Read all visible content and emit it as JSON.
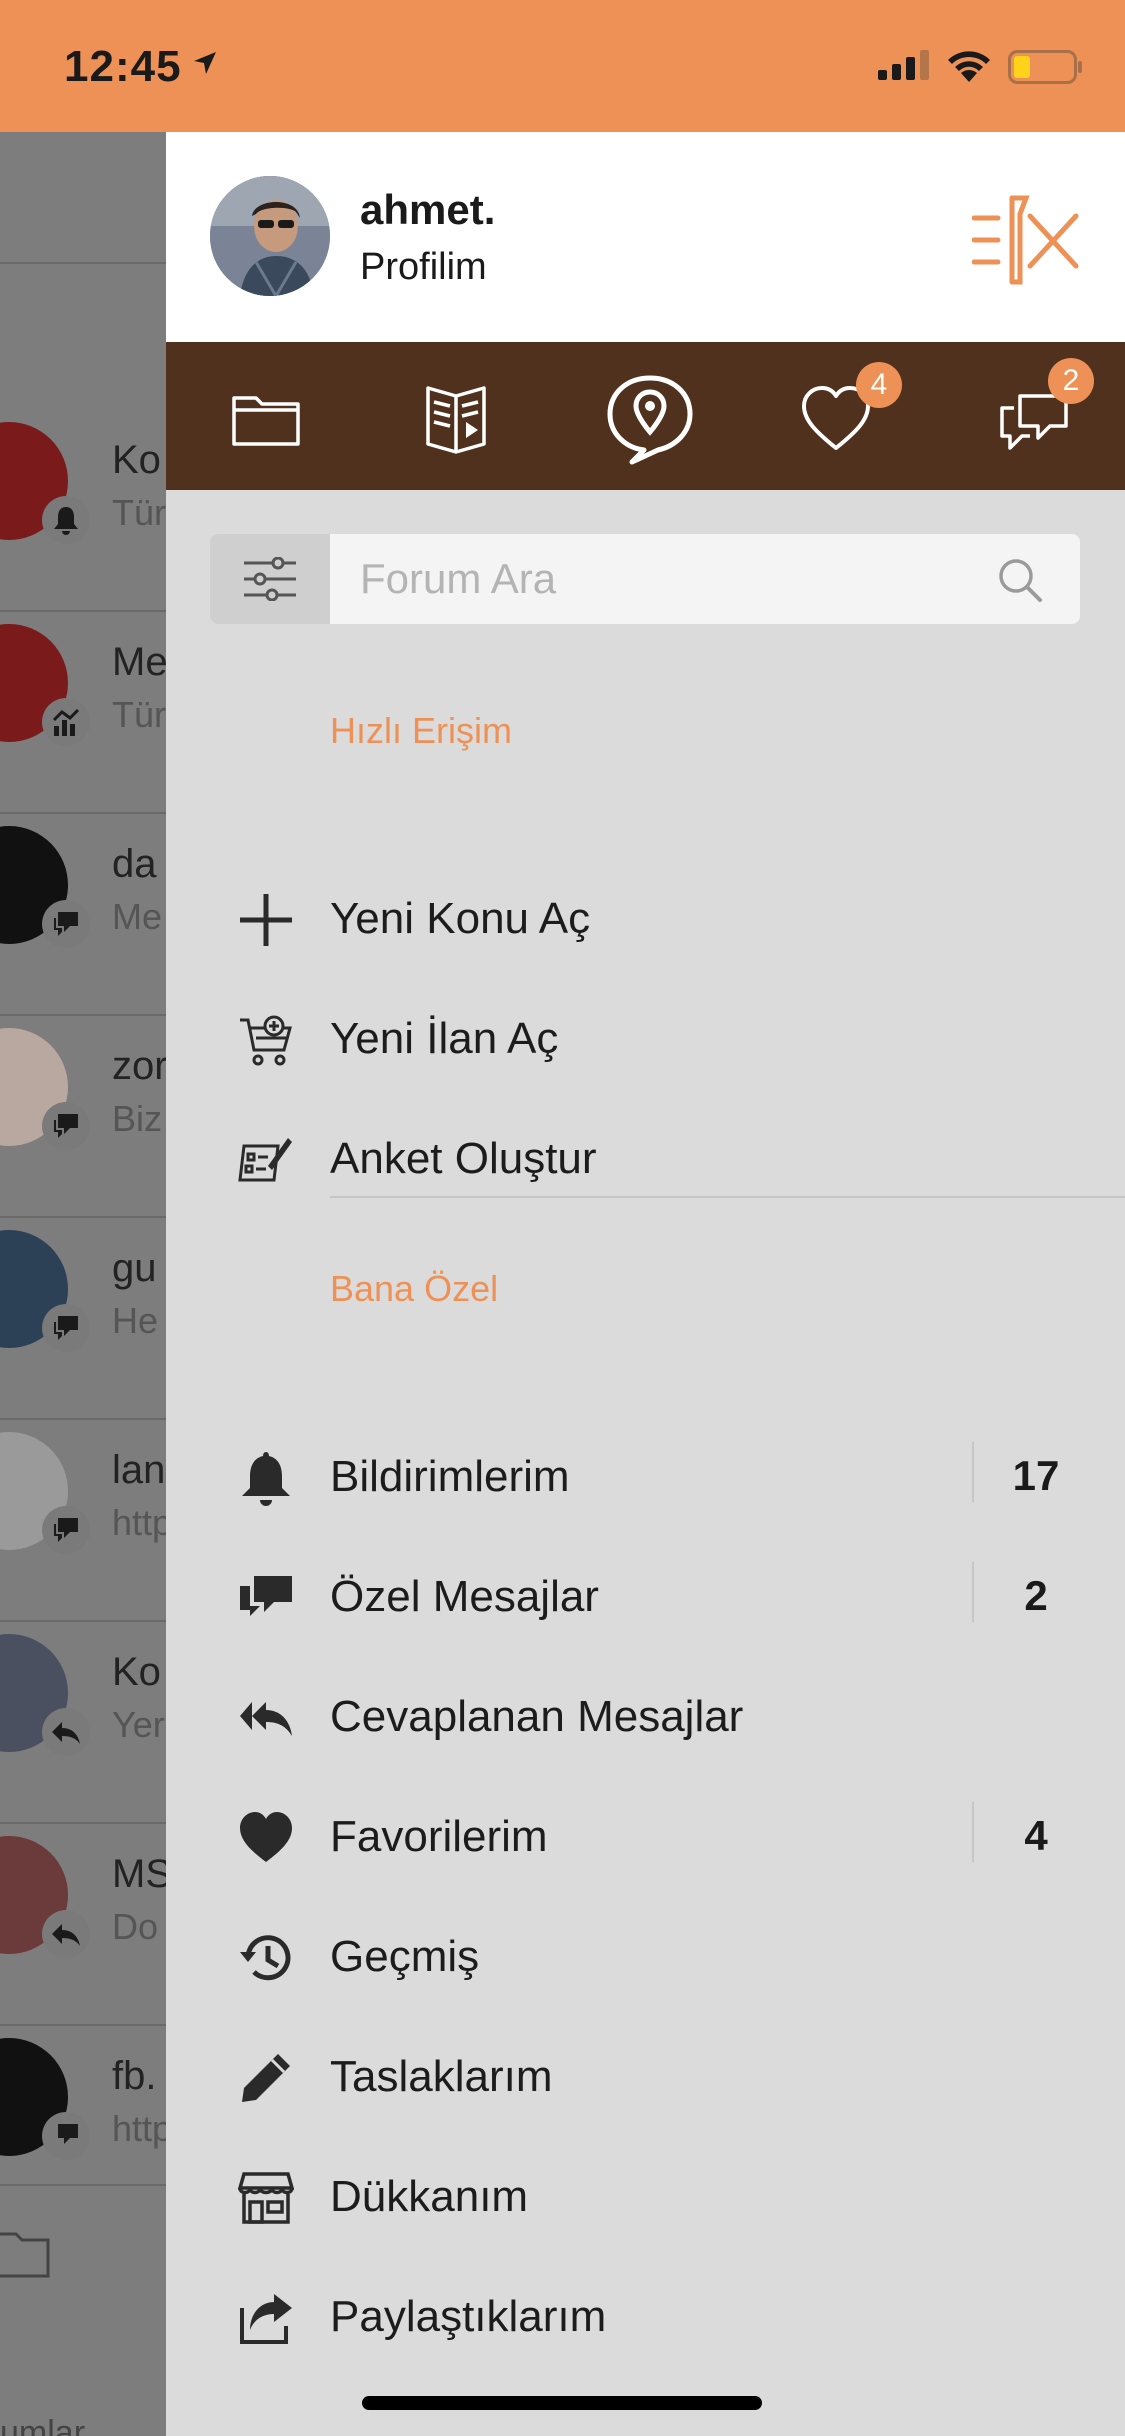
{
  "status_bar": {
    "time": "12:45"
  },
  "background_list": {
    "rows": [
      {
        "title": "Ko",
        "subtitle": "Tür"
      },
      {
        "title": "Me",
        "subtitle": "Tür"
      },
      {
        "title": "da",
        "subtitle": "Me"
      },
      {
        "title": "zor",
        "subtitle": "Biz"
      },
      {
        "title": "gu",
        "subtitle": "He"
      },
      {
        "title": "lan",
        "subtitle": "http"
      },
      {
        "title": "Ko",
        "subtitle": "Yer"
      },
      {
        "title": "MS",
        "subtitle": "Do"
      },
      {
        "title": "fb.",
        "subtitle": "http"
      }
    ],
    "tab_label": "umlar"
  },
  "profile": {
    "username": "ahmet.",
    "link_label": "Profilim"
  },
  "icon_bar": {
    "favorites_badge": "4",
    "messages_badge": "2"
  },
  "search": {
    "placeholder": "Forum Ara"
  },
  "quick_access": {
    "title": "Hızlı Erişim",
    "items": [
      {
        "label": "Yeni Konu Aç",
        "icon": "plus-icon"
      },
      {
        "label": "Yeni İlan Aç",
        "icon": "cart-add-icon"
      },
      {
        "label": "Anket Oluştur",
        "icon": "poll-icon"
      }
    ]
  },
  "personal": {
    "title": "Bana Özel",
    "items": [
      {
        "label": "Bildirimlerim",
        "icon": "bell-icon",
        "count": "17"
      },
      {
        "label": "Özel Mesajlar",
        "icon": "chat-icon",
        "count": "2"
      },
      {
        "label": "Cevaplanan Mesajlar",
        "icon": "reply-all-icon"
      },
      {
        "label": "Favorilerim",
        "icon": "heart-icon",
        "count": "4"
      },
      {
        "label": "Geçmiş",
        "icon": "history-icon"
      },
      {
        "label": "Taslaklarım",
        "icon": "pencil-icon"
      },
      {
        "label": "Dükkanım",
        "icon": "store-icon"
      },
      {
        "label": "Paylaştıklarım",
        "icon": "share-icon"
      }
    ]
  },
  "colors": {
    "accent": "#ee9156",
    "icon_bar_bg": "#50311d",
    "drawer_bg": "#dcdbdb"
  }
}
